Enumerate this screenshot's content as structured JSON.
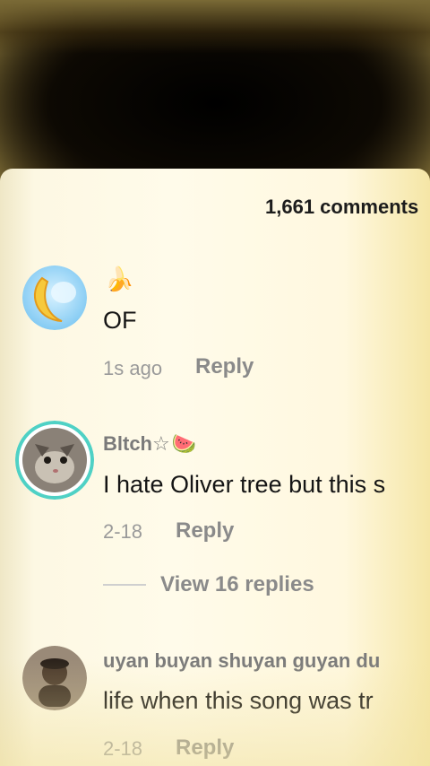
{
  "header": {
    "comment_count": "1,661 comments"
  },
  "comments": [
    {
      "username": "",
      "username_emoji": "🍌",
      "text": "OF",
      "time": "1s ago",
      "reply_label": "Reply",
      "avatar_icon": "banana-moon-avatar"
    },
    {
      "username": "Bltch☆",
      "username_emoji": "🍉",
      "text": "I hate Oliver tree but this s",
      "time": "2-18",
      "reply_label": "Reply",
      "view_replies": "View 16 replies",
      "avatar_icon": "cat-avatar"
    },
    {
      "username": "uyan buyan shuyan guyan du",
      "text": "life when this song was tr",
      "time": "2-18",
      "reply_label": "Reply",
      "avatar_icon": "person-avatar"
    }
  ],
  "colors": {
    "sheet_background": "#fffbea",
    "avatar_ring": "#4fd1c5",
    "meta_text": "#9a9a9a"
  }
}
